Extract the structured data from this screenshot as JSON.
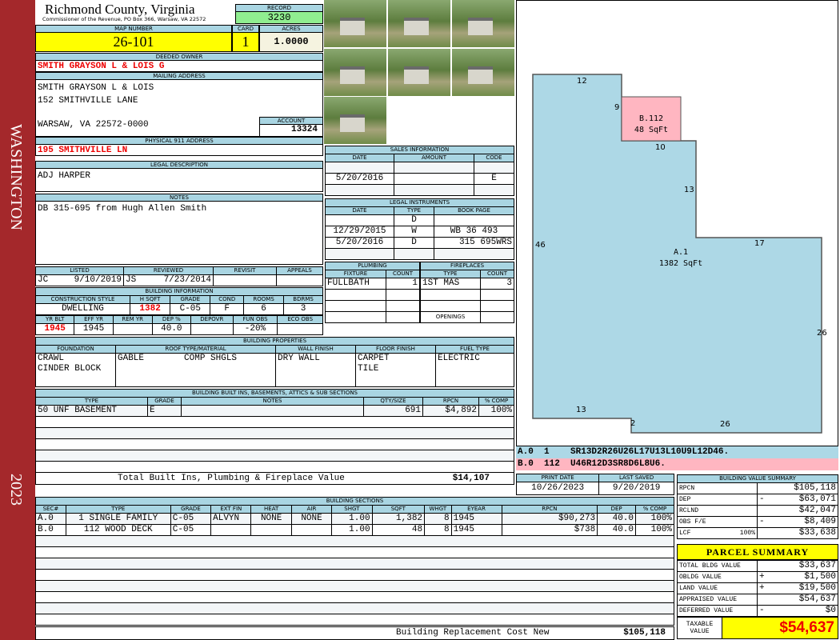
{
  "side": {
    "district": "WASHINGTON",
    "year": "2023"
  },
  "header": {
    "title": "Richmond County, Virginia",
    "subtitle": "Commissioner of the Revenue, PO Box 366, Warsaw, VA 22572",
    "record_label": "RECORD",
    "record": "3230"
  },
  "parcel": {
    "map_label": "MAP NUMBER",
    "map": "26-101",
    "card_label": "CARD",
    "card": "1",
    "acres_label": "ACRES",
    "acres": "1.0000"
  },
  "owner": {
    "label": "DEEDED OWNER",
    "name": "SMITH GRAYSON L & LOIS G",
    "mailing_label": "MAILING ADDRESS",
    "line1": "SMITH GRAYSON L & LOIS",
    "line2": "152 SMITHVILLE LANE",
    "line3": "WARSAW, VA 22572-0000",
    "account_label": "ACCOUNT",
    "account": "13324",
    "physical_label": "PHYSICAL 911 ADDRESS",
    "physical": "195 SMITHVILLE LN"
  },
  "legal": {
    "label": "LEGAL DESCRIPTION",
    "value": "ADJ HARPER"
  },
  "notes": {
    "label": "NOTES",
    "value": "DB 315-695 from Hugh Allen Smith"
  },
  "listing": {
    "headers": [
      "LISTED",
      "REVIEWED",
      "REVISIT",
      "APPEALS"
    ],
    "listed_by": "JC",
    "listed": "9/10/2019",
    "reviewed_by": "JS",
    "reviewed": "7/23/2014"
  },
  "building_info": {
    "label": "BUILDING INFORMATION",
    "h1": [
      "CONSTRUCTION STYLE",
      "H SQFT",
      "GRADE",
      "COND",
      "ROOMS",
      "BDRMS"
    ],
    "v1": [
      "DWELLING",
      "1382",
      "C-05",
      "F",
      "6",
      "3"
    ],
    "h2": [
      "YR BLT",
      "EFF YR",
      "REM YR",
      "DEP %",
      "DEPOVR",
      "FUN OBS",
      "ECO OBS"
    ],
    "v2": [
      "1945",
      "1945",
      "",
      "40.0",
      "",
      "-20%",
      ""
    ]
  },
  "sales": {
    "label": "SALES INFORMATION",
    "headers": [
      "DATE",
      "AMOUNT",
      "CODE"
    ],
    "rows": [
      [
        "",
        "",
        ""
      ],
      [
        "5/20/2016",
        "",
        "E"
      ],
      [
        "",
        "",
        ""
      ]
    ]
  },
  "instruments": {
    "label": "LEGAL INSTRUMENTS",
    "headers": [
      "DATE",
      "TYPE",
      "BOOK PAGE"
    ],
    "rows": [
      [
        "",
        "D",
        ""
      ],
      [
        "12/29/2015",
        "W",
        "WB 36 493"
      ],
      [
        "5/20/2016",
        "D",
        "315 695WRS"
      ],
      [
        "",
        "",
        ""
      ]
    ]
  },
  "plumbing": {
    "label": "PLUMBING",
    "headers": [
      "FIXTURE",
      "COUNT"
    ],
    "rows": [
      [
        "FULLBATH",
        "1"
      ]
    ]
  },
  "fireplaces": {
    "label": "FIREPLACES",
    "headers": [
      "TYPE",
      "COUNT"
    ],
    "rows": [
      [
        "1ST MAS",
        "3"
      ]
    ],
    "openings_label": "OPENINGS"
  },
  "properties": {
    "label": "BUILDING PROPERTIES",
    "headers": [
      "FOUNDATION",
      "ROOF TYPE/MATERIAL",
      "WALL FINISH",
      "FLOOR FINISH",
      "FUEL TYPE"
    ],
    "foundation": "CRAWL\nCINDER BLOCK",
    "roof_type": "GABLE",
    "roof_material": "COMP SHGLS",
    "wall": "DRY WALL",
    "floor": "CARPET\nTILE",
    "fuel": "ELECTRIC"
  },
  "builtins": {
    "label": "BUILDING BUILT INS, BASEMENTS, ATTICS & SUB SECTIONS",
    "headers": [
      "TYPE",
      "GRADE",
      "NOTES",
      "QTY/SIZE",
      "RPCN",
      "% COMP"
    ],
    "rows": [
      [
        "50 UNF BASEMENT",
        "E",
        "",
        "691",
        "$4,892",
        "100%"
      ]
    ],
    "total_label": "Total Built Ins, Plumbing & Fireplace Value",
    "total": "$14,107"
  },
  "dates": {
    "print_label": "PRINT DATE",
    "print": "10/26/2023",
    "saved_label": "LAST SAVED",
    "saved": "9/20/2019"
  },
  "sections": {
    "label": "BUILDING SECTIONS",
    "headers": [
      "SEC#",
      "TYPE",
      "GRADE",
      "EXT FIN",
      "HEAT",
      "AIR",
      "SHGT",
      "SQFT",
      "WHGT",
      "EYEAR",
      "RPCN",
      "DEP",
      "% COMP"
    ],
    "rows": [
      [
        "A.0",
        "1 SINGLE FAMILY",
        "C-05",
        "ALVYN",
        "NONE",
        "NONE",
        "1.00",
        "1,382",
        "8",
        "1945",
        "$90,273",
        "40.0",
        "100%"
      ],
      [
        "B.0",
        "112 WOOD DECK",
        "C-05",
        "",
        "",
        "",
        "1.00",
        "48",
        "8",
        "1945",
        "$738",
        "40.0",
        "100%"
      ]
    ],
    "total_label": "Building Replacement Cost New",
    "total": "$105,118"
  },
  "sketch": {
    "a_label": "A.1",
    "a_area": "1382 SqFt",
    "b_label": "B.112",
    "b_area": "48 SqFt",
    "dims": [
      "12",
      "9",
      "10",
      "13",
      "17",
      "46",
      "26",
      "13",
      "2",
      "26"
    ],
    "fill_a": "#add8e6",
    "fill_b": "#ffb6c1",
    "lines": [
      {
        "sec": "A.0",
        "code": "1",
        "path": "SR13D2R26U26L17U13L10U9L12D46."
      },
      {
        "sec": "B.0",
        "code": "112",
        "path": "U46R12D3SR8D6L8U6."
      }
    ]
  },
  "value_summary": {
    "label": "BUILDING VALUE SUMMARY",
    "rows": [
      {
        "k": "RPCN",
        "s": "",
        "v": "$105,118"
      },
      {
        "k": "DEP",
        "s": "-",
        "v": "$63,071"
      },
      {
        "k": "RCLND",
        "s": "",
        "v": "$42,047"
      },
      {
        "k": "OBS F/E",
        "s": "-",
        "v": "$8,409"
      },
      {
        "k": "LCF",
        "p": "100%",
        "s": "",
        "v": "$33,638"
      }
    ]
  },
  "parcel_summary": {
    "label": "PARCEL SUMMARY",
    "rows": [
      {
        "k": "TOTAL BLDG VALUE",
        "s": "",
        "v": "$33,637"
      },
      {
        "k": "OBLDG VALUE",
        "s": "+",
        "v": "$1,500"
      },
      {
        "k": "LAND VALUE",
        "s": "+",
        "v": "$19,500"
      },
      {
        "k": "APPRAISED VALUE",
        "s": "",
        "v": "$54,637"
      },
      {
        "k": "DEFERRED VALUE",
        "s": "-",
        "v": "$0"
      }
    ],
    "taxable_label": "TAXABLE VALUE",
    "taxable": "$54,637"
  }
}
